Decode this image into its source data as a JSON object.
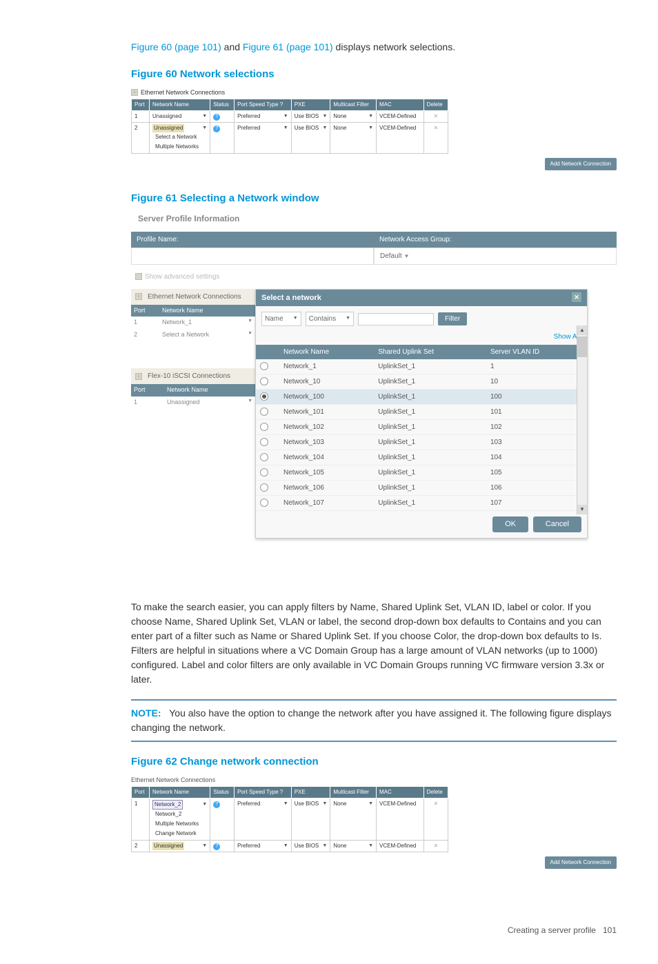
{
  "intro": {
    "link1": "Figure 60 (page 101)",
    "mid": " and ",
    "link2": "Figure 61 (page 101)",
    "tail": " displays network selections."
  },
  "fig60": {
    "caption": "Figure 60 Network selections",
    "panel_title": "Ethernet Network Connections",
    "headers": [
      "Port",
      "Network Name",
      "Status",
      "Port Speed Type  ?",
      "PXE",
      "Multicast Filter",
      "MAC",
      "Delete"
    ],
    "rows": [
      {
        "port": "1",
        "name": "Unassigned",
        "speed": "Preferred",
        "pxe": "Use BIOS",
        "mcast": "None",
        "mac": "VCEM-Defined"
      },
      {
        "port": "2",
        "name": "Unassigned",
        "name_hl": true,
        "speed": "Preferred",
        "pxe": "Use BIOS",
        "mcast": "None",
        "mac": "VCEM-Defined"
      }
    ],
    "sub_items": [
      "Select a Network",
      "Multiple Networks"
    ],
    "button": "Add Network Connection"
  },
  "fig61": {
    "caption": "Figure 61 Selecting a Network window",
    "spi": "Server Profile Information",
    "header_left": "Profile Name:",
    "header_right": "Network Access Group:",
    "nag_value": "Default",
    "chk_label": "Show advanced settings",
    "enc_title": "Ethernet Network Connections",
    "enc_headers": [
      "Port",
      "Network Name"
    ],
    "enc_rows": [
      {
        "port": "1",
        "name": "Network_1"
      },
      {
        "port": "2",
        "name": "Select a Network"
      }
    ],
    "iscsi_title": "Flex-10 iSCSI Connections",
    "iscsi_headers": [
      "Port",
      "Network Name"
    ],
    "iscsi_rows": [
      {
        "port": "1",
        "name": "Unassigned"
      }
    ],
    "panel": {
      "title": "Select a network",
      "filter_field": "Name",
      "filter_op": "Contains",
      "filter_btn": "Filter",
      "show_all": "Show All",
      "cols": [
        "",
        "Network Name",
        "Shared Uplink Set",
        "Server VLAN ID"
      ],
      "rows": [
        {
          "sel": false,
          "name": "Network_1",
          "sus": "UplinkSet_1",
          "vlan": "1"
        },
        {
          "sel": false,
          "name": "Network_10",
          "sus": "UplinkSet_1",
          "vlan": "10"
        },
        {
          "sel": true,
          "name": "Network_100",
          "sus": "UplinkSet_1",
          "vlan": "100"
        },
        {
          "sel": false,
          "name": "Network_101",
          "sus": "UplinkSet_1",
          "vlan": "101"
        },
        {
          "sel": false,
          "name": "Network_102",
          "sus": "UplinkSet_1",
          "vlan": "102"
        },
        {
          "sel": false,
          "name": "Network_103",
          "sus": "UplinkSet_1",
          "vlan": "103"
        },
        {
          "sel": false,
          "name": "Network_104",
          "sus": "UplinkSet_1",
          "vlan": "104"
        },
        {
          "sel": false,
          "name": "Network_105",
          "sus": "UplinkSet_1",
          "vlan": "105"
        },
        {
          "sel": false,
          "name": "Network_106",
          "sus": "UplinkSet_1",
          "vlan": "106"
        },
        {
          "sel": false,
          "name": "Network_107",
          "sus": "UplinkSet_1",
          "vlan": "107"
        }
      ],
      "ok": "OK",
      "cancel": "Cancel"
    }
  },
  "body_para": "To make the search easier, you can apply filters by Name, Shared Uplink Set, VLAN ID, label or color. If you choose Name, Shared Uplink Set, VLAN or label, the second drop-down box defaults to Contains and you can enter part of a filter such as Name or Shared Uplink Set. If you choose Color, the drop-down box defaults to Is. Filters are helpful in situations where a VC Domain Group has a large amount of VLAN networks (up to 1000) configured. Label and color filters are only available in VC Domain Groups running VC firmware version 3.3x or later.",
  "note": {
    "label": "NOTE:",
    "text": "You also have the option to change the network after you have assigned it. The following figure displays changing the network."
  },
  "fig62": {
    "caption": "Figure 62 Change network connection",
    "panel_title": "Ethernet Network Connections",
    "headers": [
      "Port",
      "Network Name",
      "Status",
      "Port Speed Type  ?",
      "PXE",
      "Multicast Filter",
      "MAC",
      "Delete"
    ],
    "rows": [
      {
        "port": "1",
        "name": "Network_2",
        "name_open": true,
        "speed": "Preferred",
        "pxe": "Use BIOS",
        "mcast": "None",
        "mac": "VCEM-Defined"
      },
      {
        "port": "2",
        "name": "Unassigned",
        "name_hl": true,
        "speed": "Preferred",
        "pxe": "Use BIOS",
        "mcast": "None",
        "mac": "VCEM-Defined"
      }
    ],
    "sub_items": [
      "Network_2",
      "Multiple Networks",
      "Change Network"
    ],
    "button": "Add Network Connection"
  },
  "footer": {
    "text": "Creating a server profile",
    "page": "101"
  }
}
